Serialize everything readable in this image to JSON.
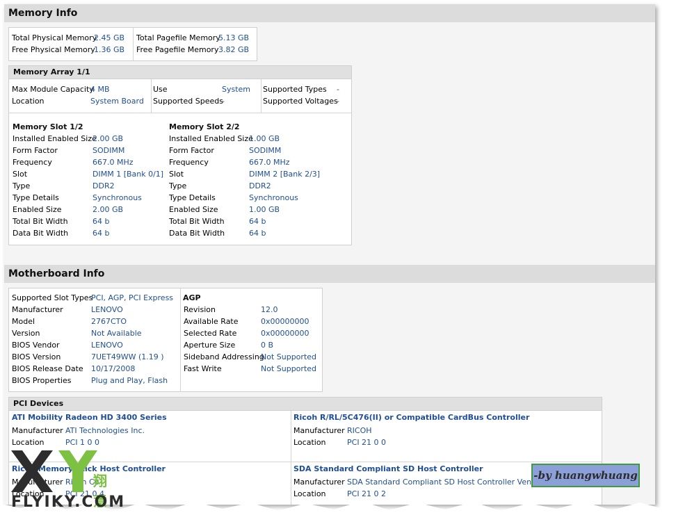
{
  "memory_info": {
    "title": "Memory Info",
    "summary_left": [
      {
        "label": "Total Physical Memory",
        "value": "2.45 GB"
      },
      {
        "label": "Free Physical Memory",
        "value": "1.36 GB"
      }
    ],
    "summary_right": [
      {
        "label": "Total Pagefile Memory",
        "value": "5.13 GB"
      },
      {
        "label": "Free Pagefile Memory",
        "value": "3.82 GB"
      }
    ],
    "array": {
      "title": "Memory Array 1/1",
      "col1": [
        {
          "label": "Max Module Capacity",
          "value": "4 MB"
        },
        {
          "label": "Location",
          "value": "System Board"
        }
      ],
      "col2": [
        {
          "label": "Use",
          "value": "System"
        },
        {
          "label": "Supported Speeds",
          "value": "-"
        }
      ],
      "col3": [
        {
          "label": "Supported Types",
          "value": "-"
        },
        {
          "label": "Supported Voltages",
          "value": "-"
        }
      ]
    },
    "slots": [
      {
        "title": "Memory Slot 1/2",
        "rows": [
          {
            "label": "Installed Enabled Size",
            "value": "2.00 GB"
          },
          {
            "label": "Form Factor",
            "value": "SODIMM"
          },
          {
            "label": "Frequency",
            "value": "667.0 MHz"
          },
          {
            "label": "Slot",
            "value": "DIMM 1 [Bank 0/1]"
          },
          {
            "label": "Type",
            "value": "DDR2"
          },
          {
            "label": "Type Details",
            "value": "Synchronous"
          },
          {
            "label": "Enabled Size",
            "value": "2.00 GB"
          },
          {
            "label": "Total Bit Width",
            "value": "64 b"
          },
          {
            "label": "Data Bit Width",
            "value": "64 b"
          }
        ]
      },
      {
        "title": "Memory Slot 2/2",
        "rows": [
          {
            "label": "Installed Enabled Size",
            "value": "1.00 GB"
          },
          {
            "label": "Form Factor",
            "value": "SODIMM"
          },
          {
            "label": "Frequency",
            "value": "667.0 MHz"
          },
          {
            "label": "Slot",
            "value": "DIMM 2 [Bank 2/3]"
          },
          {
            "label": "Type",
            "value": "DDR2"
          },
          {
            "label": "Type Details",
            "value": "Synchronous"
          },
          {
            "label": "Enabled Size",
            "value": "1.00 GB"
          },
          {
            "label": "Total Bit Width",
            "value": "64 b"
          },
          {
            "label": "Data Bit Width",
            "value": "64 b"
          }
        ]
      }
    ]
  },
  "motherboard_info": {
    "title": "Motherboard Info",
    "left": [
      {
        "label": "Supported Slot Types",
        "value": "PCI, AGP, PCI Express"
      },
      {
        "label": "Manufacturer",
        "value": "LENOVO"
      },
      {
        "label": "Model",
        "value": "2767CTO"
      },
      {
        "label": "Version",
        "value": "Not Available"
      },
      {
        "label": "BIOS Vendor",
        "value": "LENOVO"
      },
      {
        "label": "BIOS Version",
        "value": "7UET49WW (1.19 )"
      },
      {
        "label": "BIOS Release Date",
        "value": "10/17/2008"
      },
      {
        "label": "BIOS Properties",
        "value": "Plug and Play, Flash"
      }
    ],
    "agp": {
      "title": "AGP",
      "rows": [
        {
          "label": "Revision",
          "value": "12.0"
        },
        {
          "label": "Available Rate",
          "value": "0x00000000"
        },
        {
          "label": "Selected Rate",
          "value": "0x00000000"
        },
        {
          "label": "Aperture Size",
          "value": "0 B"
        },
        {
          "label": "Sideband Addressing",
          "value": "Not Supported"
        },
        {
          "label": "Fast Write",
          "value": "Not Supported"
        }
      ]
    },
    "pci": {
      "title": "PCI Devices",
      "devices": [
        {
          "name": "ATI Mobility Radeon HD 3400 Series",
          "rows": [
            {
              "label": "Manufacturer",
              "value": "ATI Technologies Inc."
            },
            {
              "label": "Location",
              "value": "PCI 1 0 0"
            }
          ]
        },
        {
          "name": "Ricoh R/RL/5C476(II) or Compatible CardBus Controller",
          "rows": [
            {
              "label": "Manufacturer",
              "value": "RICOH"
            },
            {
              "label": "Location",
              "value": "PCI 21 0 0"
            }
          ]
        },
        {
          "name": "Ricoh Memory Stick Host Controller",
          "rows": [
            {
              "label": "Manufacturer",
              "value": "Ricoh Co"
            },
            {
              "label": "Location",
              "value": "PCI 21 0 4"
            }
          ]
        },
        {
          "name": "SDA Standard Compliant SD Host Controller",
          "rows": [
            {
              "label": "Manufacturer",
              "value": "SDA Standard Compliant SD Host Controller Vendor"
            },
            {
              "label": "Location",
              "value": "PCI 21 0 2"
            }
          ]
        }
      ]
    }
  },
  "watermark": {
    "credit": "-by huangwhuang",
    "logo_text": "FLYIKY.COM",
    "logo_letters": "XY",
    "logo_cn": "翔意"
  },
  "colors": {
    "value": "#1f4e96",
    "header_bg": "#dcdcdc",
    "subheader_bg": "#e0e0e0",
    "page_bg": "#f4f4f4"
  }
}
